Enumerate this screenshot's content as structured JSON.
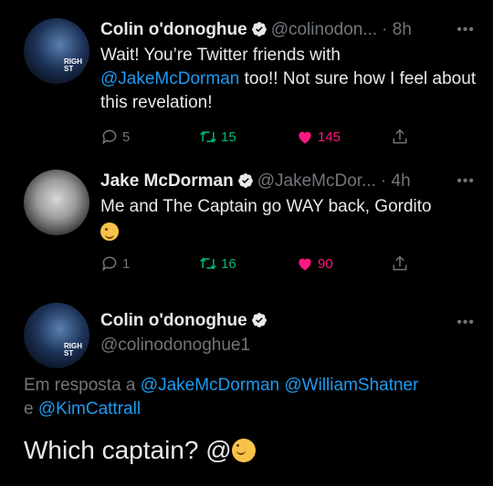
{
  "tweets": [
    {
      "name": "Colin o'donoghue",
      "handle": "@colinodon...",
      "time": "· 8h",
      "text_prefix": "Wait! You’re Twitter friends with ",
      "mention": "@JakeMcDorman",
      "text_suffix": " too!! Not sure how I feel about this revelation!",
      "replies": "5",
      "retweets": "15",
      "likes": "145",
      "avatar_text": "RIGH\nST"
    },
    {
      "name": "Jake McDorman",
      "handle": "@JakeMcDor...",
      "time": "· 4h",
      "text": "Me and The Captain go WAY back, Gordito",
      "replies": "1",
      "retweets": "16",
      "likes": "90"
    }
  ],
  "main_tweet": {
    "name": "Colin o'donoghue",
    "handle": "@colinodonoghue1",
    "reply_prefix": "Em resposta a ",
    "reply_mention_1": "@JakeMcDorman",
    "reply_mention_2": "@WilliamShatner",
    "reply_conj": "e ",
    "reply_mention_3": "@KimCattrall",
    "text": "Which captain? @"
  },
  "colors": {
    "background": "#000000",
    "link": "#1d9bf0",
    "retweet": "#00ba7c",
    "like": "#f91880",
    "muted": "#71767b"
  },
  "icons": [
    "verified-badge-icon",
    "reply-icon",
    "retweet-icon",
    "heart-icon",
    "share-icon",
    "more-icon",
    "wink-emoji-icon"
  ]
}
